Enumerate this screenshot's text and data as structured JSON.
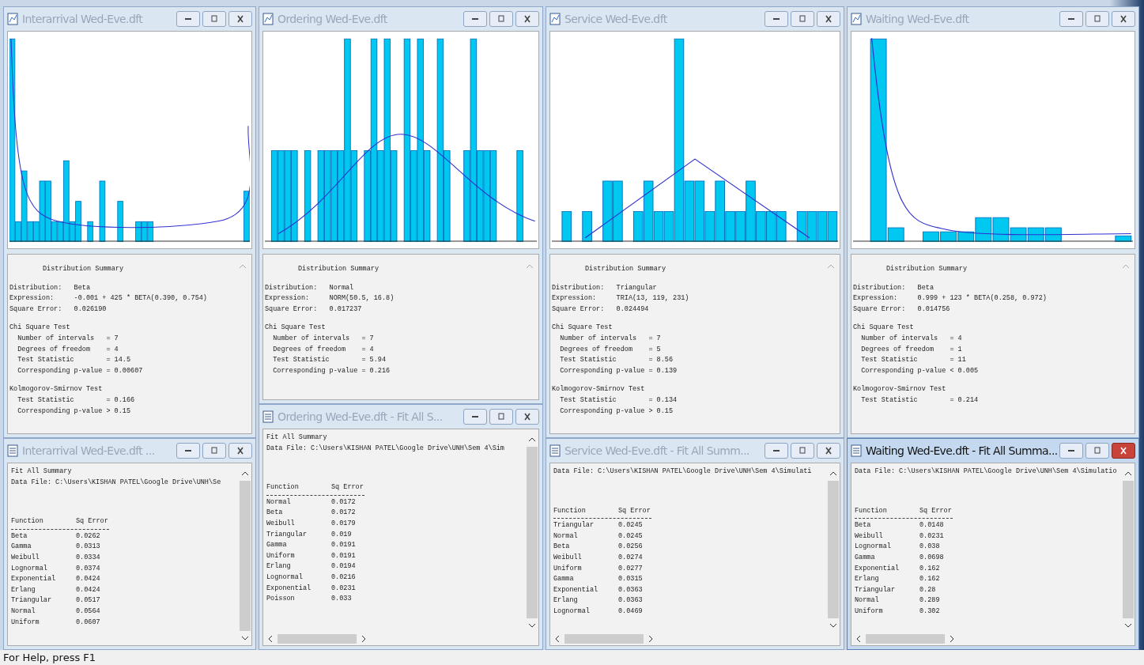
{
  "windows": [
    {
      "title": "Interarrival Wed-Eve.dft",
      "active": false,
      "summary": {
        "heading": "Distribution Summary",
        "lines": [
          "Distribution:   Beta",
          "Expression:     -0.001 + 425 * BETA(0.390, 0.754)",
          "Square Error:   0.026190"
        ],
        "tests": [
          {
            "title": "Chi Square Test",
            "lines": [
              "  Number of intervals   = 7",
              "  Degrees of freedom    = 4",
              "  Test Statistic        = 14.5",
              "  Corresponding p-value = 0.00607"
            ]
          },
          {
            "title": "Kolmogorov-Smirnov Test",
            "lines": [
              "  Test Statistic        = 0.166",
              "  Corresponding p-value > 0.15"
            ]
          }
        ]
      },
      "fit": {
        "title": "Interarrival Wed-Eve.dft ...",
        "active": false,
        "header_lines": [
          "Fit All Summary",
          "Data File: C:\\Users\\KISHAN PATEL\\Google Drive\\UNH\\Se"
        ],
        "columns": [
          "Function",
          "Sq Error"
        ],
        "rows": [
          [
            "Beta",
            "0.0262"
          ],
          [
            "Gamma",
            "0.0313"
          ],
          [
            "Weibull",
            "0.0334"
          ],
          [
            "Lognormal",
            "0.0374"
          ],
          [
            "Exponential",
            "0.0424"
          ],
          [
            "Erlang",
            "0.0424"
          ],
          [
            "Triangular",
            "0.0517"
          ],
          [
            "Normal",
            "0.0564"
          ],
          [
            "Uniform",
            "0.0607"
          ]
        ]
      }
    },
    {
      "title": "Ordering Wed-Eve.dft",
      "active": false,
      "summary": {
        "heading": "Distribution Summary",
        "lines": [
          "Distribution:   Normal",
          "Expression:     NORM(50.5, 16.8)",
          "Square Error:   0.017237"
        ],
        "tests": [
          {
            "title": "Chi Square Test",
            "lines": [
              "  Number of intervals   = 7",
              "  Degrees of freedom    = 4",
              "  Test Statistic        = 5.94",
              "  Corresponding p-value = 0.216"
            ]
          }
        ]
      },
      "fit": {
        "title": "Ordering Wed-Eve.dft - Fit All S...",
        "active": false,
        "header_lines": [
          "Fit All Summary",
          "Data File: C:\\Users\\KISHAN PATEL\\Google Drive\\UNH\\Sem 4\\Sim"
        ],
        "columns": [
          "Function",
          "Sq Error"
        ],
        "rows": [
          [
            "Normal",
            "0.0172"
          ],
          [
            "Beta",
            "0.0172"
          ],
          [
            "Weibull",
            "0.0179"
          ],
          [
            "Triangular",
            "0.019"
          ],
          [
            "Gamma",
            "0.0191"
          ],
          [
            "Uniform",
            "0.0191"
          ],
          [
            "Erlang",
            "0.0194"
          ],
          [
            "Lognormal",
            "0.0216"
          ],
          [
            "Exponential",
            "0.0231"
          ],
          [
            "Poisson",
            "0.033"
          ]
        ]
      }
    },
    {
      "title": "Service Wed-Eve.dft",
      "active": false,
      "summary": {
        "heading": "Distribution Summary",
        "lines": [
          "Distribution:   Triangular",
          "Expression:     TRIA(13, 119, 231)",
          "Square Error:   0.024494"
        ],
        "tests": [
          {
            "title": "Chi Square Test",
            "lines": [
              "  Number of intervals   = 7",
              "  Degrees of freedom    = 5",
              "  Test Statistic        = 8.56",
              "  Corresponding p-value = 0.139"
            ]
          },
          {
            "title": "Kolmogorov-Smirnov Test",
            "lines": [
              "  Test Statistic        = 0.134",
              "  Corresponding p-value > 0.15"
            ]
          }
        ]
      },
      "fit": {
        "title": "Service Wed-Eve.dft - Fit All Summ...",
        "active": false,
        "header_lines": [
          "Data File: C:\\Users\\KISHAN PATEL\\Google Drive\\UNH\\Sem 4\\Simulati"
        ],
        "columns": [
          "Function",
          "Sq Error"
        ],
        "rows": [
          [
            "Triangular",
            "0.0245"
          ],
          [
            "Normal",
            "0.0245"
          ],
          [
            "Beta",
            "0.0256"
          ],
          [
            "Weibull",
            "0.0274"
          ],
          [
            "Uniform",
            "0.0277"
          ],
          [
            "Gamma",
            "0.0315"
          ],
          [
            "Exponential",
            "0.0363"
          ],
          [
            "Erlang",
            "0.0363"
          ],
          [
            "Lognormal",
            "0.0469"
          ]
        ]
      }
    },
    {
      "title": "Waiting Wed-Eve.dft",
      "active": false,
      "summary": {
        "heading": "Distribution Summary",
        "lines": [
          "Distribution:   Beta",
          "Expression:     0.999 + 123 * BETA(0.258, 0.972)",
          "Square Error:   0.014756"
        ],
        "tests": [
          {
            "title": "Chi Square Test",
            "lines": [
              "  Number of intervals   = 4",
              "  Degrees of freedom    = 1",
              "  Test Statistic        = 11",
              "  Corresponding p-value < 0.005"
            ]
          },
          {
            "title": "Kolmogorov-Smirnov Test",
            "lines": [
              "  Test Statistic        = 0.214"
            ]
          }
        ]
      },
      "fit": {
        "title": "Waiting Wed-Eve.dft - Fit All Summa...",
        "active": true,
        "header_lines": [
          "Data File: C:\\Users\\KISHAN PATEL\\Google Drive\\UNH\\Sem 4\\Simulatio"
        ],
        "columns": [
          "Function",
          "Sq Error"
        ],
        "rows": [
          [
            "Beta",
            "0.0148"
          ],
          [
            "Weibull",
            "0.0231"
          ],
          [
            "Lognormal",
            "0.038"
          ],
          [
            "Gamma",
            "0.0698"
          ],
          [
            "Exponential",
            "0.162"
          ],
          [
            "Erlang",
            "0.162"
          ],
          [
            "Triangular",
            "0.28"
          ],
          [
            "Normal",
            "0.289"
          ],
          [
            "Uniform",
            "0.302"
          ]
        ]
      }
    }
  ],
  "status_bar": "For Help, press F1"
}
